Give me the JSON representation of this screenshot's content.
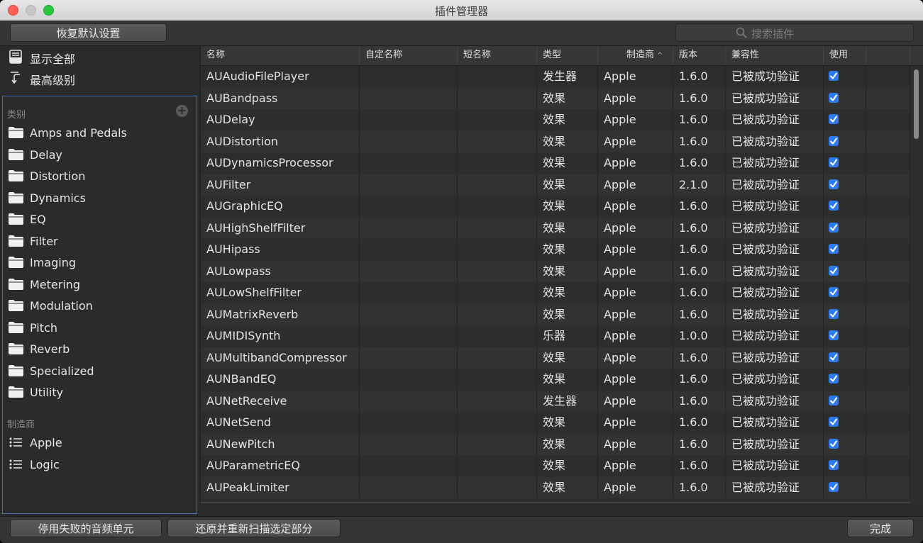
{
  "window": {
    "title": "插件管理器"
  },
  "toolbar": {
    "restore_label": "恢复默认设置",
    "search_placeholder": "搜索插件"
  },
  "sidebar": {
    "show_all": "显示全部",
    "top_level": "最高级别",
    "category_header": "类别",
    "categories": [
      "Amps and Pedals",
      "Delay",
      "Distortion",
      "Dynamics",
      "EQ",
      "Filter",
      "Imaging",
      "Metering",
      "Modulation",
      "Pitch",
      "Reverb",
      "Specialized",
      "Utility"
    ],
    "manufacturer_header": "制造商",
    "manufacturers": [
      "Apple",
      "Logic"
    ]
  },
  "table": {
    "columns": [
      "名称",
      "自定名称",
      "短名称",
      "类型",
      "制造商",
      "版本",
      "兼容性",
      "使用"
    ],
    "sort_column": "制造商",
    "rows": [
      {
        "name": "AUAudioFilePlayer",
        "custom": "",
        "short": "",
        "type": "发生器",
        "maker": "Apple",
        "version": "1.6.0",
        "compat": "已被成功验证",
        "use": true
      },
      {
        "name": "AUBandpass",
        "custom": "",
        "short": "",
        "type": "效果",
        "maker": "Apple",
        "version": "1.6.0",
        "compat": "已被成功验证",
        "use": true
      },
      {
        "name": "AUDelay",
        "custom": "",
        "short": "",
        "type": "效果",
        "maker": "Apple",
        "version": "1.6.0",
        "compat": "已被成功验证",
        "use": true
      },
      {
        "name": "AUDistortion",
        "custom": "",
        "short": "",
        "type": "效果",
        "maker": "Apple",
        "version": "1.6.0",
        "compat": "已被成功验证",
        "use": true
      },
      {
        "name": "AUDynamicsProcessor",
        "custom": "",
        "short": "",
        "type": "效果",
        "maker": "Apple",
        "version": "1.6.0",
        "compat": "已被成功验证",
        "use": true
      },
      {
        "name": "AUFilter",
        "custom": "",
        "short": "",
        "type": "效果",
        "maker": "Apple",
        "version": "2.1.0",
        "compat": "已被成功验证",
        "use": true
      },
      {
        "name": "AUGraphicEQ",
        "custom": "",
        "short": "",
        "type": "效果",
        "maker": "Apple",
        "version": "1.6.0",
        "compat": "已被成功验证",
        "use": true
      },
      {
        "name": "AUHighShelfFilter",
        "custom": "",
        "short": "",
        "type": "效果",
        "maker": "Apple",
        "version": "1.6.0",
        "compat": "已被成功验证",
        "use": true
      },
      {
        "name": "AUHipass",
        "custom": "",
        "short": "",
        "type": "效果",
        "maker": "Apple",
        "version": "1.6.0",
        "compat": "已被成功验证",
        "use": true
      },
      {
        "name": "AULowpass",
        "custom": "",
        "short": "",
        "type": "效果",
        "maker": "Apple",
        "version": "1.6.0",
        "compat": "已被成功验证",
        "use": true
      },
      {
        "name": "AULowShelfFilter",
        "custom": "",
        "short": "",
        "type": "效果",
        "maker": "Apple",
        "version": "1.6.0",
        "compat": "已被成功验证",
        "use": true
      },
      {
        "name": "AUMatrixReverb",
        "custom": "",
        "short": "",
        "type": "效果",
        "maker": "Apple",
        "version": "1.6.0",
        "compat": "已被成功验证",
        "use": true
      },
      {
        "name": "AUMIDISynth",
        "custom": "",
        "short": "",
        "type": "乐器",
        "maker": "Apple",
        "version": "1.0.0",
        "compat": "已被成功验证",
        "use": true
      },
      {
        "name": "AUMultibandCompressor",
        "custom": "",
        "short": "",
        "type": "效果",
        "maker": "Apple",
        "version": "1.6.0",
        "compat": "已被成功验证",
        "use": true
      },
      {
        "name": "AUNBandEQ",
        "custom": "",
        "short": "",
        "type": "效果",
        "maker": "Apple",
        "version": "1.6.0",
        "compat": "已被成功验证",
        "use": true
      },
      {
        "name": "AUNetReceive",
        "custom": "",
        "short": "",
        "type": "发生器",
        "maker": "Apple",
        "version": "1.6.0",
        "compat": "已被成功验证",
        "use": true
      },
      {
        "name": "AUNetSend",
        "custom": "",
        "short": "",
        "type": "效果",
        "maker": "Apple",
        "version": "1.6.0",
        "compat": "已被成功验证",
        "use": true
      },
      {
        "name": "AUNewPitch",
        "custom": "",
        "short": "",
        "type": "效果",
        "maker": "Apple",
        "version": "1.6.0",
        "compat": "已被成功验证",
        "use": true
      },
      {
        "name": "AUParametricEQ",
        "custom": "",
        "short": "",
        "type": "效果",
        "maker": "Apple",
        "version": "1.6.0",
        "compat": "已被成功验证",
        "use": true
      },
      {
        "name": "AUPeakLimiter",
        "custom": "",
        "short": "",
        "type": "效果",
        "maker": "Apple",
        "version": "1.6.0",
        "compat": "已被成功验证",
        "use": true
      }
    ]
  },
  "bottombar": {
    "disable_label": "停用失败的音频单元",
    "rescan_label": "还原并重新扫描选定部分",
    "done_label": "完成"
  },
  "colors": {
    "accent": "#2d7bf0",
    "selection_border": "#3f6fb0"
  }
}
